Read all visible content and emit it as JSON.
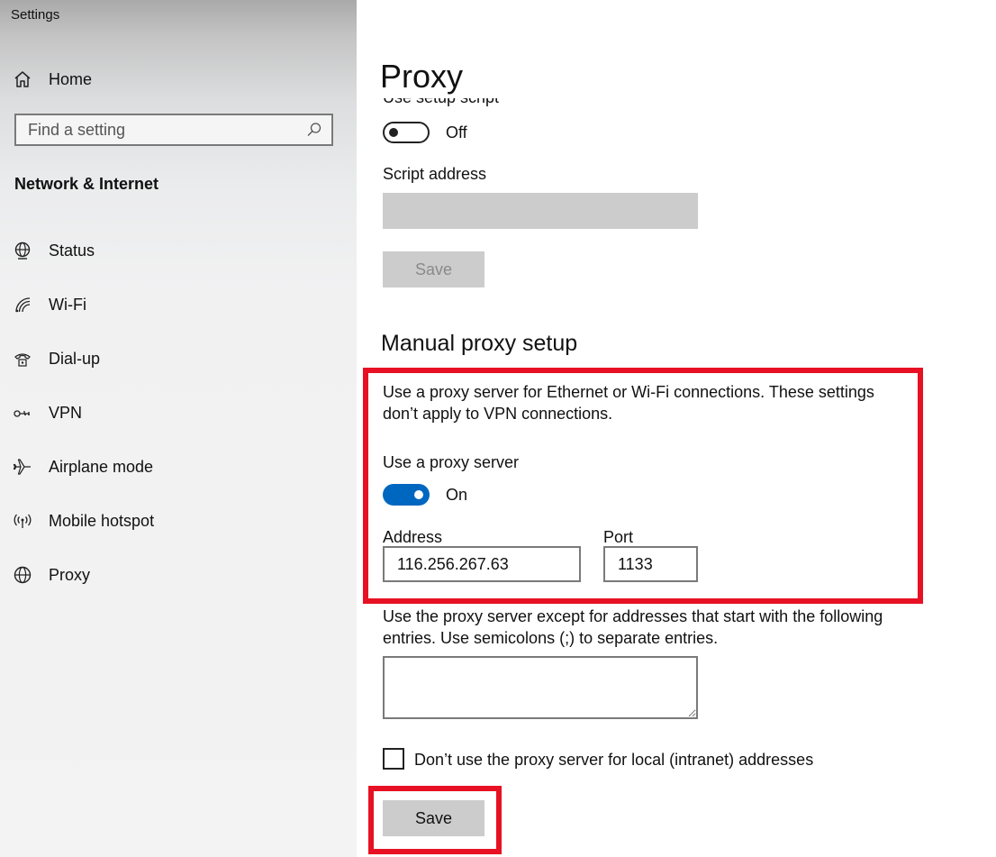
{
  "window": {
    "title": "Settings"
  },
  "sidebar": {
    "home_label": "Home",
    "search_placeholder": "Find a setting",
    "section_title": "Network & Internet",
    "items": [
      {
        "label": "Status",
        "icon": "globe-status-icon"
      },
      {
        "label": "Wi-Fi",
        "icon": "wifi-icon"
      },
      {
        "label": "Dial-up",
        "icon": "dialup-phone-icon"
      },
      {
        "label": "VPN",
        "icon": "vpn-icon"
      },
      {
        "label": "Airplane mode",
        "icon": "airplane-icon"
      },
      {
        "label": "Mobile hotspot",
        "icon": "hotspot-icon"
      },
      {
        "label": "Proxy",
        "icon": "globe-icon"
      }
    ]
  },
  "main": {
    "page_title": "Proxy",
    "setup_script": {
      "cut_label": "Use setup script",
      "toggle_state": "Off",
      "script_address_label": "Script address",
      "script_address_value": "",
      "save_label": "Save"
    },
    "manual": {
      "heading": "Manual proxy setup",
      "description_line1": "Use a proxy server for Ethernet or Wi-Fi connections. These settings",
      "description_line2": "don’t apply to VPN connections.",
      "use_proxy_label": "Use a proxy server",
      "toggle_state": "On",
      "address_label": "Address",
      "address_value": "116.256.267.63",
      "port_label": "Port",
      "port_value": "1133",
      "exceptions_line1": "Use the proxy server except for addresses that start with the following",
      "exceptions_line2": "entries. Use semicolons (;) to separate entries.",
      "exceptions_value": "",
      "local_checkbox_label": "Don’t use the proxy server for local (intranet) addresses",
      "local_checkbox_checked": false,
      "save_label": "Save"
    }
  },
  "colors": {
    "accent": "#0067c0",
    "highlight": "#e81123",
    "disabled_fill": "#cccccc"
  }
}
